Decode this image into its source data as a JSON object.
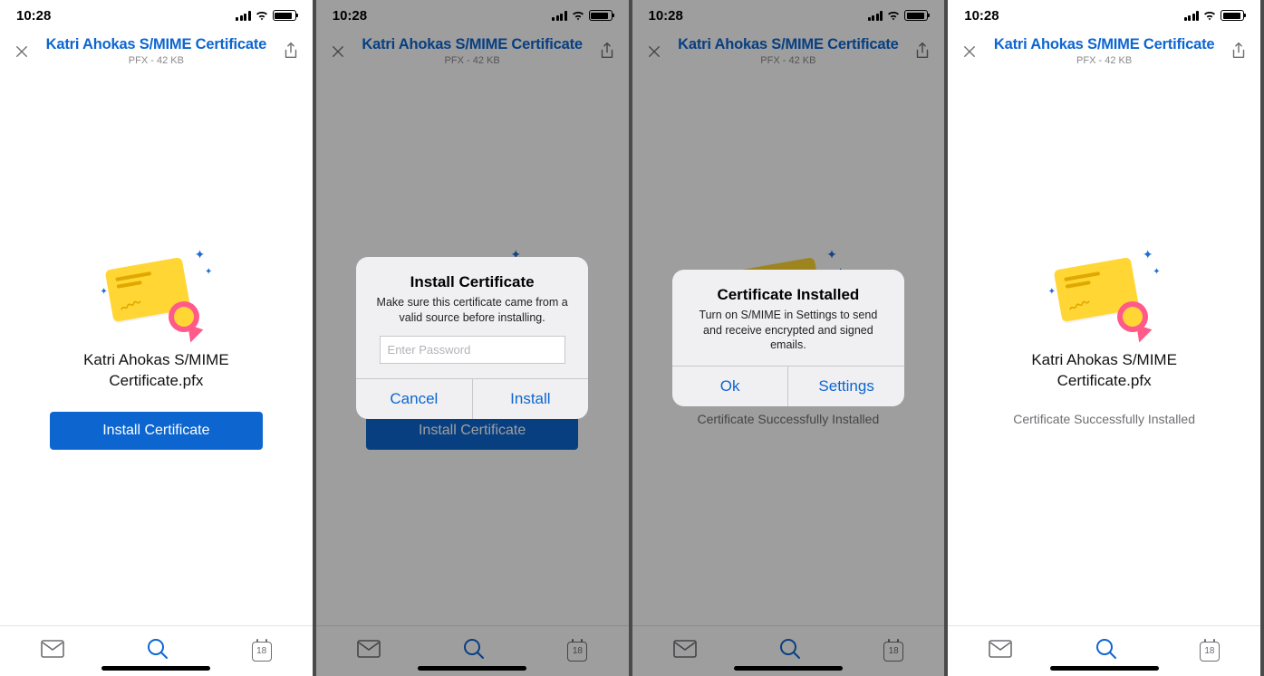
{
  "status": {
    "time": "10:28"
  },
  "header": {
    "title": "Katri Ahokas S/MIME Certificate",
    "subtitle": "PFX - 42 KB"
  },
  "filename_line1": "Katri Ahokas S/MIME",
  "filename_line2": "Certificate.pfx",
  "install_button": "Install Certificate",
  "success_text": "Certificate Successfully Installed",
  "calendar_day": "18",
  "dialog_install": {
    "title": "Install Certificate",
    "message": "Make sure this certificate came from a valid source before installing.",
    "placeholder": "Enter Password",
    "cancel": "Cancel",
    "confirm": "Install"
  },
  "dialog_done": {
    "title": "Certificate Installed",
    "message": "Turn on S/MIME in Settings to send and receive encrypted and signed emails.",
    "ok": "Ok",
    "settings": "Settings"
  }
}
